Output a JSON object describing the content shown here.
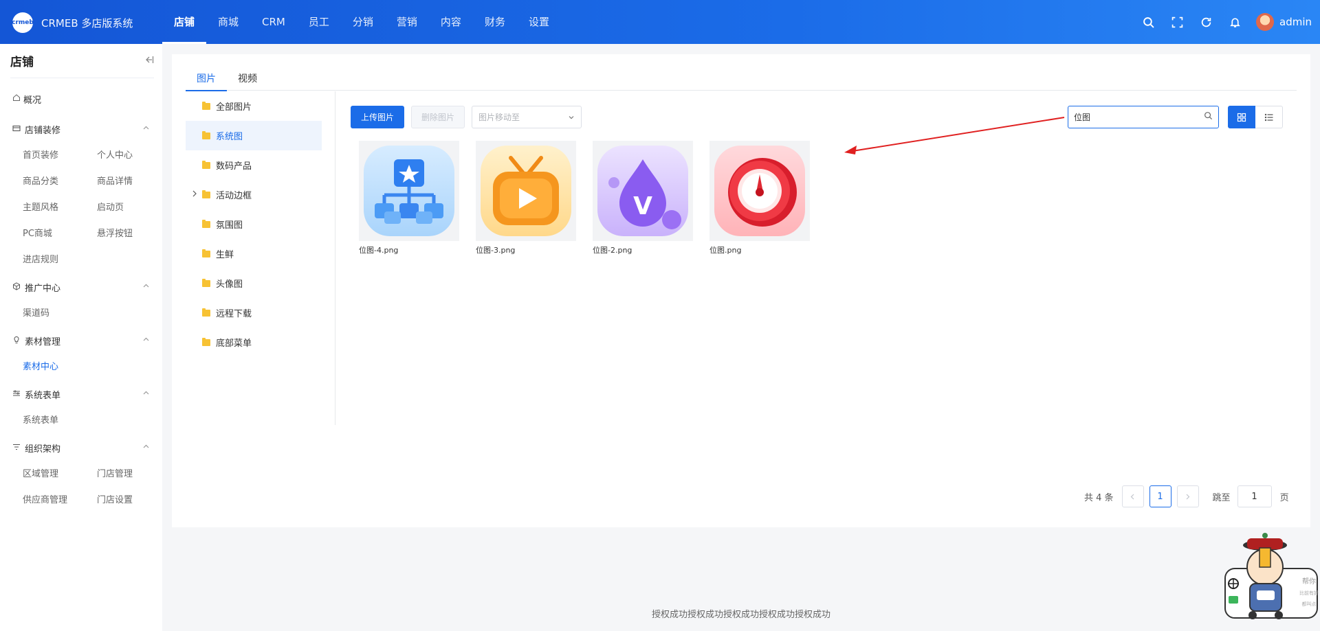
{
  "brand": {
    "logo_text": "crmeb",
    "title": "CRMEB 多店版系统"
  },
  "topnav": [
    {
      "label": "店铺",
      "active": true
    },
    {
      "label": "商城"
    },
    {
      "label": "CRM"
    },
    {
      "label": "员工"
    },
    {
      "label": "分销"
    },
    {
      "label": "营销"
    },
    {
      "label": "内容"
    },
    {
      "label": "财务"
    },
    {
      "label": "设置"
    }
  ],
  "user": {
    "name": "admin"
  },
  "sidebar": {
    "title": "店铺",
    "overview": "概况",
    "groups": [
      {
        "label": "店铺装修",
        "items": [
          "首页装修",
          "个人中心",
          "商品分类",
          "商品详情",
          "主题风格",
          "启动页",
          "PC商城",
          "悬浮按钮",
          "进店规则"
        ]
      },
      {
        "label": "推广中心",
        "items": [
          "渠道码"
        ]
      },
      {
        "label": "素材管理",
        "items": [
          "素材中心"
        ]
      },
      {
        "label": "系统表单",
        "items": [
          "系统表单"
        ]
      },
      {
        "label": "组织架构",
        "items": [
          "区域管理",
          "门店管理",
          "供应商管理",
          "门店设置"
        ]
      }
    ]
  },
  "tabs": [
    "图片",
    "视频"
  ],
  "folders": [
    "全部图片",
    "系统图",
    "数码产品",
    "活动边框",
    "氛围图",
    "生鲜",
    "头像图",
    "远程下载",
    "底部菜单"
  ],
  "toolbar": {
    "upload": "上传图片",
    "delete": "删除图片",
    "move_placeholder": "图片移动至"
  },
  "search": {
    "value": "位图"
  },
  "images": [
    {
      "name": "位图-4.png"
    },
    {
      "name": "位图-3.png"
    },
    {
      "name": "位图-2.png"
    },
    {
      "name": "位图.png"
    }
  ],
  "pagination": {
    "total": "共 4 条",
    "current": "1",
    "jump_label": "跳至",
    "jump_value": "1",
    "page_suffix": "页"
  },
  "footer": {
    "text": "授权成功授权成功授权成功授权成功授权成功"
  },
  "colors": {
    "primary": "#1b6ce8",
    "annotation_arrow": "#e02020"
  }
}
